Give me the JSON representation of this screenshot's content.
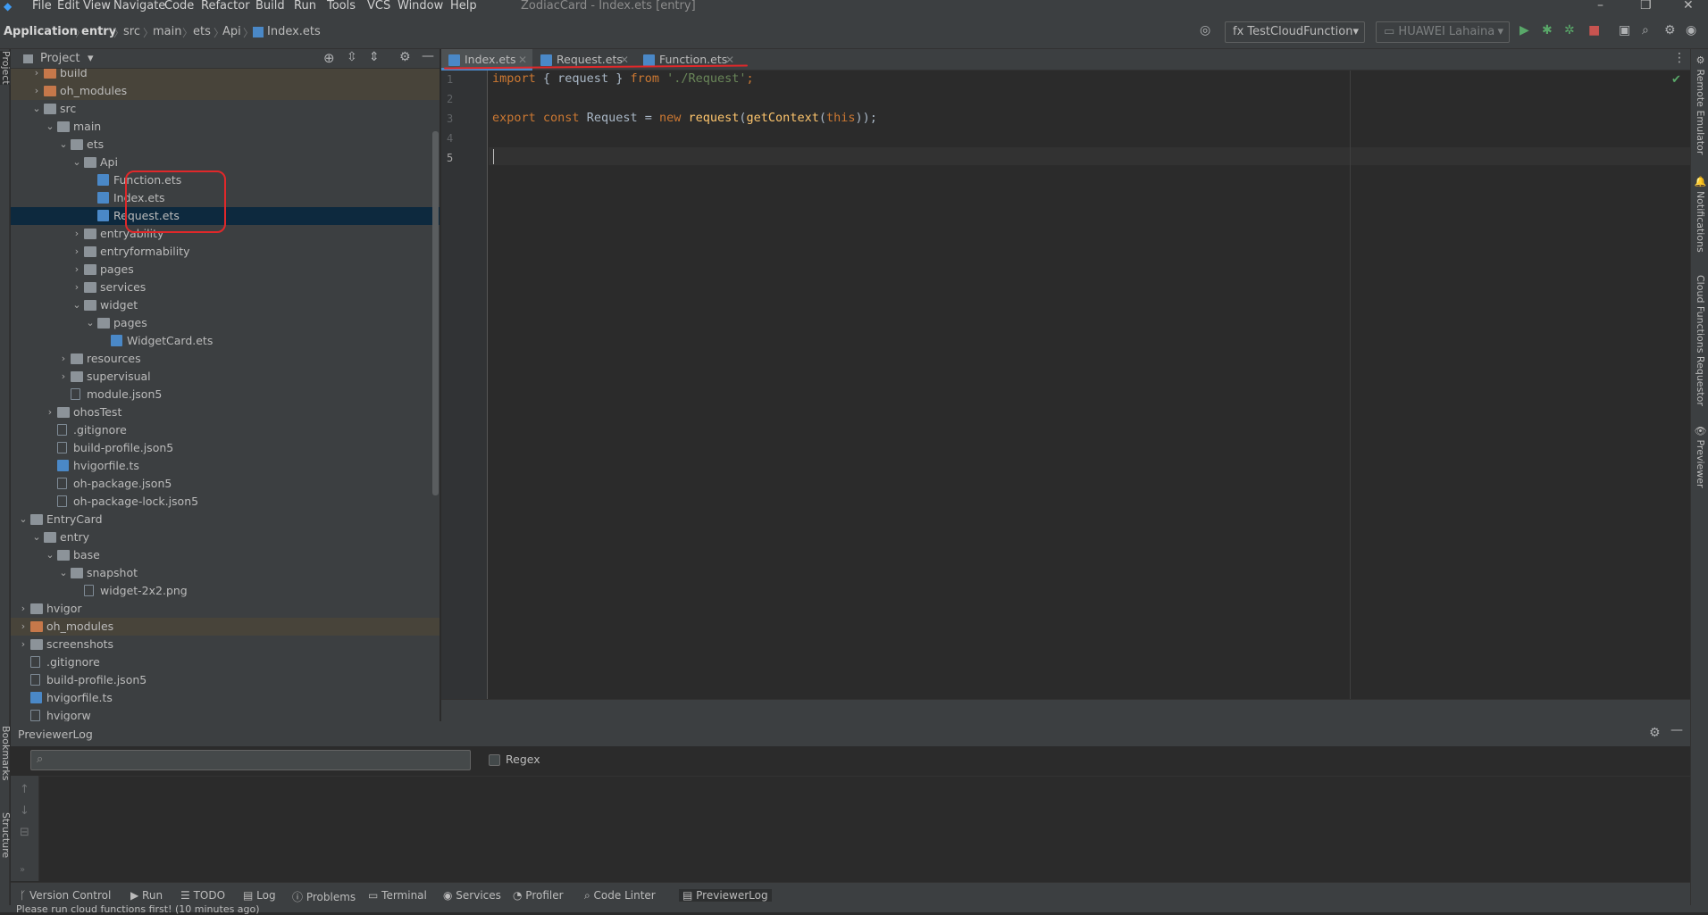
{
  "window": {
    "title": "ZodiacCard - Index.ets [entry]"
  },
  "menu": [
    "File",
    "Edit",
    "View",
    "Navigate",
    "Code",
    "Refactor",
    "Build",
    "Run",
    "Tools",
    "VCS",
    "Window",
    "Help"
  ],
  "breadcrumb": [
    "Application",
    "entry",
    "src",
    "main",
    "ets",
    "Api",
    "Index.ets"
  ],
  "toolbar": {
    "config": "TestCloudFunction",
    "device": "HUAWEI Lahaina"
  },
  "project_panel": {
    "title": "Project"
  },
  "tree": [
    {
      "label": "build",
      "kind": "folder",
      "depth": 2,
      "arrow": "right",
      "excluded": true
    },
    {
      "label": "oh_modules",
      "kind": "folder",
      "depth": 2,
      "arrow": "right",
      "excluded": true
    },
    {
      "label": "src",
      "kind": "folder",
      "depth": 2,
      "arrow": "down"
    },
    {
      "label": "main",
      "kind": "folder",
      "depth": 3,
      "arrow": "down"
    },
    {
      "label": "ets",
      "kind": "folder",
      "depth": 4,
      "arrow": "down"
    },
    {
      "label": "Api",
      "kind": "folder",
      "depth": 5,
      "arrow": "down"
    },
    {
      "label": "Function.ets",
      "kind": "ets",
      "depth": 6
    },
    {
      "label": "Index.ets",
      "kind": "ets",
      "depth": 6
    },
    {
      "label": "Request.ets",
      "kind": "ets",
      "depth": 6,
      "selected": true
    },
    {
      "label": "entryability",
      "kind": "folder",
      "depth": 5,
      "arrow": "right"
    },
    {
      "label": "entryformability",
      "kind": "folder",
      "depth": 5,
      "arrow": "right"
    },
    {
      "label": "pages",
      "kind": "folder",
      "depth": 5,
      "arrow": "right"
    },
    {
      "label": "services",
      "kind": "folder",
      "depth": 5,
      "arrow": "right"
    },
    {
      "label": "widget",
      "kind": "folder",
      "depth": 5,
      "arrow": "down"
    },
    {
      "label": "pages",
      "kind": "folder",
      "depth": 6,
      "arrow": "down"
    },
    {
      "label": "WidgetCard.ets",
      "kind": "ets",
      "depth": 7
    },
    {
      "label": "resources",
      "kind": "folder",
      "depth": 4,
      "arrow": "right"
    },
    {
      "label": "supervisual",
      "kind": "folder",
      "depth": 4,
      "arrow": "right"
    },
    {
      "label": "module.json5",
      "kind": "file",
      "depth": 4
    },
    {
      "label": "ohosTest",
      "kind": "folder",
      "depth": 3,
      "arrow": "right"
    },
    {
      "label": ".gitignore",
      "kind": "file",
      "depth": 3
    },
    {
      "label": "build-profile.json5",
      "kind": "file",
      "depth": 3
    },
    {
      "label": "hvigorfile.ts",
      "kind": "ets",
      "depth": 3
    },
    {
      "label": "oh-package.json5",
      "kind": "file",
      "depth": 3
    },
    {
      "label": "oh-package-lock.json5",
      "kind": "file",
      "depth": 3
    },
    {
      "label": "EntryCard",
      "kind": "folder",
      "depth": 1,
      "arrow": "down"
    },
    {
      "label": "entry",
      "kind": "folder",
      "depth": 2,
      "arrow": "down"
    },
    {
      "label": "base",
      "kind": "folder",
      "depth": 3,
      "arrow": "down"
    },
    {
      "label": "snapshot",
      "kind": "folder",
      "depth": 4,
      "arrow": "down"
    },
    {
      "label": "widget-2x2.png",
      "kind": "file",
      "depth": 5
    },
    {
      "label": "hvigor",
      "kind": "folder",
      "depth": 1,
      "arrow": "right"
    },
    {
      "label": "oh_modules",
      "kind": "folder",
      "depth": 1,
      "arrow": "right",
      "excluded": true
    },
    {
      "label": "screenshots",
      "kind": "folder",
      "depth": 1,
      "arrow": "right"
    },
    {
      "label": ".gitignore",
      "kind": "file",
      "depth": 1
    },
    {
      "label": "build-profile.json5",
      "kind": "file",
      "depth": 1
    },
    {
      "label": "hvigorfile.ts",
      "kind": "ets",
      "depth": 1
    },
    {
      "label": "hvigorw",
      "kind": "file",
      "depth": 1
    }
  ],
  "tabs": [
    "Index.ets",
    "Request.ets",
    "Function.ets"
  ],
  "editor": {
    "line_numbers": [
      "1",
      "2",
      "3",
      "4",
      "5"
    ],
    "line1": {
      "k1": "import",
      "p1": " { ",
      "id1": "request",
      "p2": " } ",
      "k2": "from",
      "p3": " ",
      "s1": "'./Request'",
      "p4": ";"
    },
    "line3": {
      "k1": "export",
      "p1": " ",
      "k2": "const",
      "p2": " Request = ",
      "k3": "new",
      "p3": " ",
      "f1": "request",
      "p4": "(",
      "f2": "getContext",
      "p5": "(",
      "k4": "this",
      "p6": "));"
    }
  },
  "right_strip": [
    "Remote Emulator",
    "Notifications",
    "Cloud Functions Requestor",
    "Previewer"
  ],
  "left_strip": {
    "top": "Project",
    "bottom1": "Bookmarks",
    "bottom2": "Structure"
  },
  "previewer_log": {
    "title": "PreviewerLog",
    "search_placeholder": "",
    "regex_label": "Regex"
  },
  "tool_windows": [
    "Version Control",
    "Run",
    "TODO",
    "Log",
    "Problems",
    "Terminal",
    "Services",
    "Profiler",
    "Code Linter",
    "PreviewerLog"
  ],
  "status": {
    "message": "Please run cloud functions first! (10 minutes ago)"
  },
  "colors": {
    "keyword": "#cc7832",
    "string": "#6a8759",
    "function": "#ffc66d",
    "selection": "#0d293e",
    "annotation": "#e0282a"
  }
}
